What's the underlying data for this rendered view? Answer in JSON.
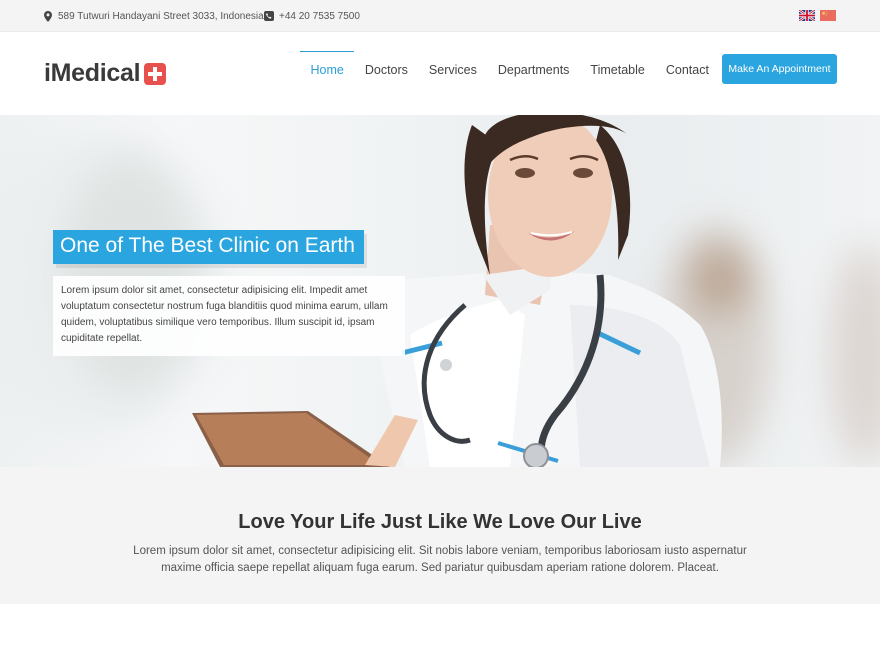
{
  "topbar": {
    "address": "589 Tutwuri Handayani Street 3033, Indonesia",
    "phone": "+44 20 7535 7500",
    "address_icon": "map-pin-icon",
    "phone_icon": "phone-icon",
    "flags": [
      "uk-flag-icon",
      "china-flag-icon"
    ]
  },
  "header": {
    "logo_text": "iMedical",
    "logo_icon": "medical-cross-icon",
    "nav": {
      "home": "Home",
      "doctors": "Doctors",
      "services": "Services",
      "departments": "Departments",
      "timetable": "Timetable",
      "contact": "Contact"
    },
    "active_nav": "Home",
    "cta_label": "Make An Appointment"
  },
  "hero": {
    "title": "One of The Best Clinic on Earth",
    "text": "Lorem ipsum dolor sit amet, consectetur adipisicing elit. Impedit amet voluptatum consectetur nostrum fuga blanditiis quod minima earum, ullam quidem, voluptatibus similique vero temporibus. Illum suscipit id, ipsam cupiditate repellat."
  },
  "intro": {
    "title": "Love Your Life Just Like We Love Our Live",
    "text": "Lorem ipsum dolor sit amet, consectetur adipisicing elit. Sit nobis labore veniam, temporibus laboriosam iusto aspernatur maxime officia saepe repellat aliquam fuga earum. Sed pariatur quibusdam aperiam ratione dolorem. Placeat."
  },
  "colors": {
    "accent": "#2aa5e0",
    "logo_cross": "#e8504d",
    "topbar_bg": "#f4f4f4",
    "section_bg": "#f4f4f4"
  }
}
